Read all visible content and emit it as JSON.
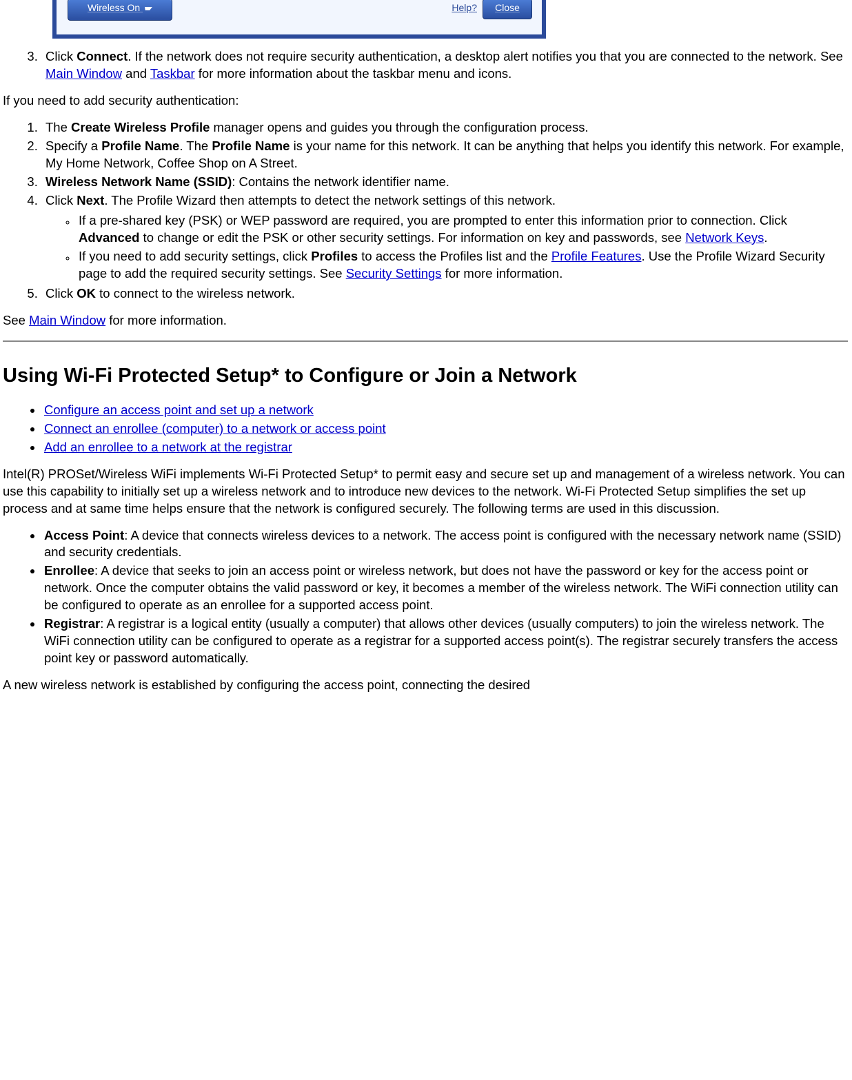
{
  "toolbar": {
    "wireless_label": "Wireless On",
    "help_label": "Help?",
    "close_label": "Close"
  },
  "step3": {
    "pre": "Click ",
    "bold": "Connect",
    "mid1": ". If the network does not require security authentication, a desktop alert notifies you that you are connected to the network. See ",
    "link1": "Main Window",
    "mid2": " and ",
    "link2": "Taskbar",
    "tail": " for more information about the taskbar menu and icons."
  },
  "para_security_intro": "If you need to add security authentication:",
  "sec_list": {
    "i1": {
      "pre": "The ",
      "bold": "Create Wireless Profile",
      "tail": " manager opens and guides you through the configuration process."
    },
    "i2": {
      "pre": "Specify a ",
      "b1": "Profile Name",
      "mid": ". The ",
      "b2": "Profile Name",
      "tail": " is your name for this network. It can be anything that helps you identify this network. For example, My Home Network, Coffee Shop on A Street."
    },
    "i3": {
      "b": "Wireless Network Name (SSID)",
      "tail": ": Contains the network identifier name."
    },
    "i4": {
      "pre": "Click ",
      "b": "Next",
      "tail": ". The Profile Wizard then attempts to detect the network settings of this network.",
      "s1": {
        "pre": "If a pre-shared key (PSK) or WEP password are required, you are prompted to enter this information prior to connection. Click ",
        "b": "Advanced",
        "mid": " to change or edit the PSK or other security settings. For information on key and passwords, see ",
        "link": "Network Keys",
        "end": "."
      },
      "s2": {
        "pre": "If you need to add security settings, click ",
        "b": "Profiles",
        "mid": " to access the Profiles list and the ",
        "link1": "Profile Features",
        "mid2": ". Use the Profile Wizard Security page to add the required security settings. See ",
        "link2": "Security Settings",
        "end": " for more information."
      }
    },
    "i5": {
      "pre": "Click ",
      "b": "OK",
      "tail": " to connect to the wireless network."
    }
  },
  "see_main": {
    "pre": "See ",
    "link": "Main Window",
    "tail": " for more information."
  },
  "h2": "Using Wi-Fi Protected Setup* to Configure or Join a Network",
  "bullets": {
    "b1": "Configure an access point and set up a network ",
    "b2": "Connect an enrollee (computer) to a network or access point ",
    "b3": "Add an enrollee to a network at the registrar"
  },
  "para_wps": "Intel(R) PROSet/Wireless WiFi implements Wi-Fi Protected Setup* to permit easy and secure set up and management of a wireless network. You can use this capability to initially set up a wireless network and to introduce new devices to the network. Wi-Fi Protected Setup simplifies the set up process and at same time helps ensure that the network is configured securely. The following terms are used in this discussion.",
  "defs": {
    "ap": {
      "term": "Access Point",
      "text": ": A device that connects wireless devices to a network. The access point is configured with the necessary network name (SSID) and security credentials."
    },
    "en": {
      "term": "Enrollee",
      "text": ": A device that seeks to join an access point or wireless network, but does not have the password or key for the access point or network. Once the computer obtains the valid password or key, it becomes a member of the wireless network. The WiFi connection utility can be configured to operate as an enrollee for a supported access point."
    },
    "reg": {
      "term": "Registrar",
      "text": ": A registrar is a logical entity (usually a computer) that allows other devices (usually computers) to join the wireless network. The WiFi connection utility can be configured to operate as a registrar for a supported access point(s). The registrar securely transfers the access point key or password automatically."
    }
  },
  "para_end": "A new wireless network is established by configuring the access point, connecting the desired"
}
